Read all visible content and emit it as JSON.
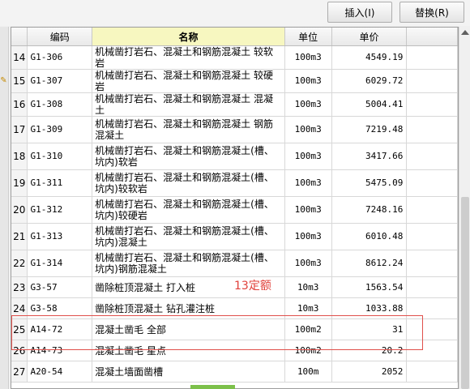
{
  "toolbar": {
    "insert_label": "插入(I)",
    "replace_label": "替换(R)"
  },
  "table": {
    "headers": {
      "code": "编码",
      "name": "名称",
      "unit": "单位",
      "price": "单价"
    },
    "rows": [
      {
        "idx": "14",
        "code": "G1-306",
        "name": "机械凿打岩石、混凝土和钢筋混凝土 较软岩",
        "unit": "100m3",
        "price": "4549.19"
      },
      {
        "idx": "15",
        "code": "G1-307",
        "name": "机械凿打岩石、混凝土和钢筋混凝土 较硬岩",
        "unit": "100m3",
        "price": "6029.72"
      },
      {
        "idx": "16",
        "code": "G1-308",
        "name": "机械凿打岩石、混凝土和钢筋混凝土 混凝土",
        "unit": "100m3",
        "price": "5004.41"
      },
      {
        "idx": "17",
        "code": "G1-309",
        "name": "机械凿打岩石、混凝土和钢筋混凝土 钢筋混凝土",
        "unit": "100m3",
        "price": "7219.48"
      },
      {
        "idx": "18",
        "code": "G1-310",
        "name": "机械凿打岩石、混凝土和钢筋混凝土(槽、坑内)软岩",
        "unit": "100m3",
        "price": "3417.66"
      },
      {
        "idx": "19",
        "code": "G1-311",
        "name": "机械凿打岩石、混凝土和钢筋混凝土(槽、坑内)较软岩",
        "unit": "100m3",
        "price": "5475.09"
      },
      {
        "idx": "20",
        "code": "G1-312",
        "name": "机械凿打岩石、混凝土和钢筋混凝土(槽、坑内)较硬岩",
        "unit": "100m3",
        "price": "7248.16"
      },
      {
        "idx": "21",
        "code": "G1-313",
        "name": "机械凿打岩石、混凝土和钢筋混凝土(槽、坑内)混凝土",
        "unit": "100m3",
        "price": "6010.48"
      },
      {
        "idx": "22",
        "code": "G1-314",
        "name": "机械凿打岩石、混凝土和钢筋混凝土(槽、坑内)钢筋混凝土",
        "unit": "100m3",
        "price": "8612.24"
      },
      {
        "idx": "23",
        "code": "G3-57",
        "name": "凿除桩顶混凝土 打入桩",
        "unit": "10m3",
        "price": "1563.54"
      },
      {
        "idx": "24",
        "code": "G3-58",
        "name": "凿除桩顶混凝土 钻孔灌注桩",
        "unit": "10m3",
        "price": "1033.88"
      },
      {
        "idx": "25",
        "code": "A14-72",
        "name": "混凝土凿毛 全部",
        "unit": "100m2",
        "price": "31"
      },
      {
        "idx": "26",
        "code": "A14-73",
        "name": "混凝土凿毛 星点",
        "unit": "100m2",
        "price": "20.2"
      },
      {
        "idx": "27",
        "code": "A20-54",
        "name": "混凝土墙面凿槽",
        "unit": "100m",
        "price": "2052"
      }
    ]
  },
  "annotation": {
    "text": "13定额",
    "color": "#e0403a"
  },
  "colors": {
    "header_highlight": "#f7f7c0",
    "annotation_box": "#e0504b"
  }
}
